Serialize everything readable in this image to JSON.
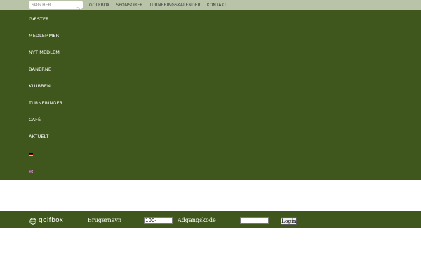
{
  "search": {
    "placeholder": "SØG HER..."
  },
  "topnav": {
    "items": [
      "GOLFBOX",
      "SPONSORER",
      "TURNERINGSKALENDER",
      "KONTAKT"
    ]
  },
  "menu": {
    "items": [
      "GÆSTER",
      "MEDLEMMER",
      "NYT MEDLEM",
      "BANERNE",
      "KLUBBEN",
      "TURNERINGER",
      "CAFÉ",
      "AKTUELT"
    ]
  },
  "languages": [
    "german-flag-icon",
    "uk-flag-icon"
  ],
  "footer": {
    "logo_text": "golfbox",
    "username_label": "Brugernavn",
    "username_value": "100-",
    "password_label": "Adgangskode",
    "password_value": "",
    "login_label": "Login"
  },
  "colors": {
    "topbar": "#b9c3a8",
    "menu_bg": "#3f561c",
    "footer_bg": "#3f561c"
  }
}
